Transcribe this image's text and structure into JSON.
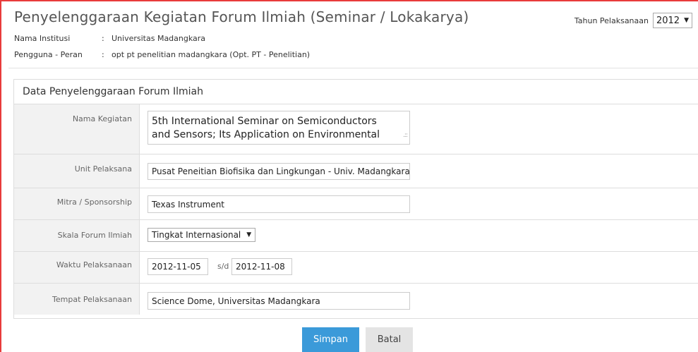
{
  "header": {
    "title": "Penyelenggaraan Kegiatan Forum Ilmiah (Seminar / Lokakarya)",
    "institution_label": "Nama Institusi",
    "institution_value": "Universitas Madangkara",
    "user_label": "Pengguna - Peran",
    "user_value": "opt pt penelitian madangkara (Opt. PT - Penelitian)",
    "separator": ":",
    "year_label": "Tahun Pelaksanaan",
    "year_value": "2012"
  },
  "panel": {
    "title": "Data Penyelenggaraan Forum Ilmiah",
    "fields": {
      "nama_kegiatan": {
        "label": "Nama Kegiatan",
        "value_line1": "5th International Seminar on Semiconductors",
        "value_line2": "and Sensors; Its Application on Environmental"
      },
      "unit_pelaksana": {
        "label": "Unit Pelaksana",
        "value": "Pusat Peneitian Biofisika dan Lingkungan - Univ. Madangkara"
      },
      "mitra": {
        "label": "Mitra / Sponsorship",
        "value": "Texas Instrument"
      },
      "skala": {
        "label": "Skala Forum Ilmiah",
        "value": "Tingkat Internasional"
      },
      "waktu": {
        "label": "Waktu Pelaksanaan",
        "start": "2012-11-05",
        "separator": "s/d",
        "end": "2012-11-08"
      },
      "tempat": {
        "label": "Tempat Pelaksanaan",
        "value": "Science Dome, Universitas Madangkara"
      }
    }
  },
  "actions": {
    "save_label": "Simpan",
    "cancel_label": "Batal"
  },
  "colors": {
    "primary": "#3b9ad9",
    "frame_border": "#e83b3b",
    "label_bg": "#f2f2f2"
  }
}
